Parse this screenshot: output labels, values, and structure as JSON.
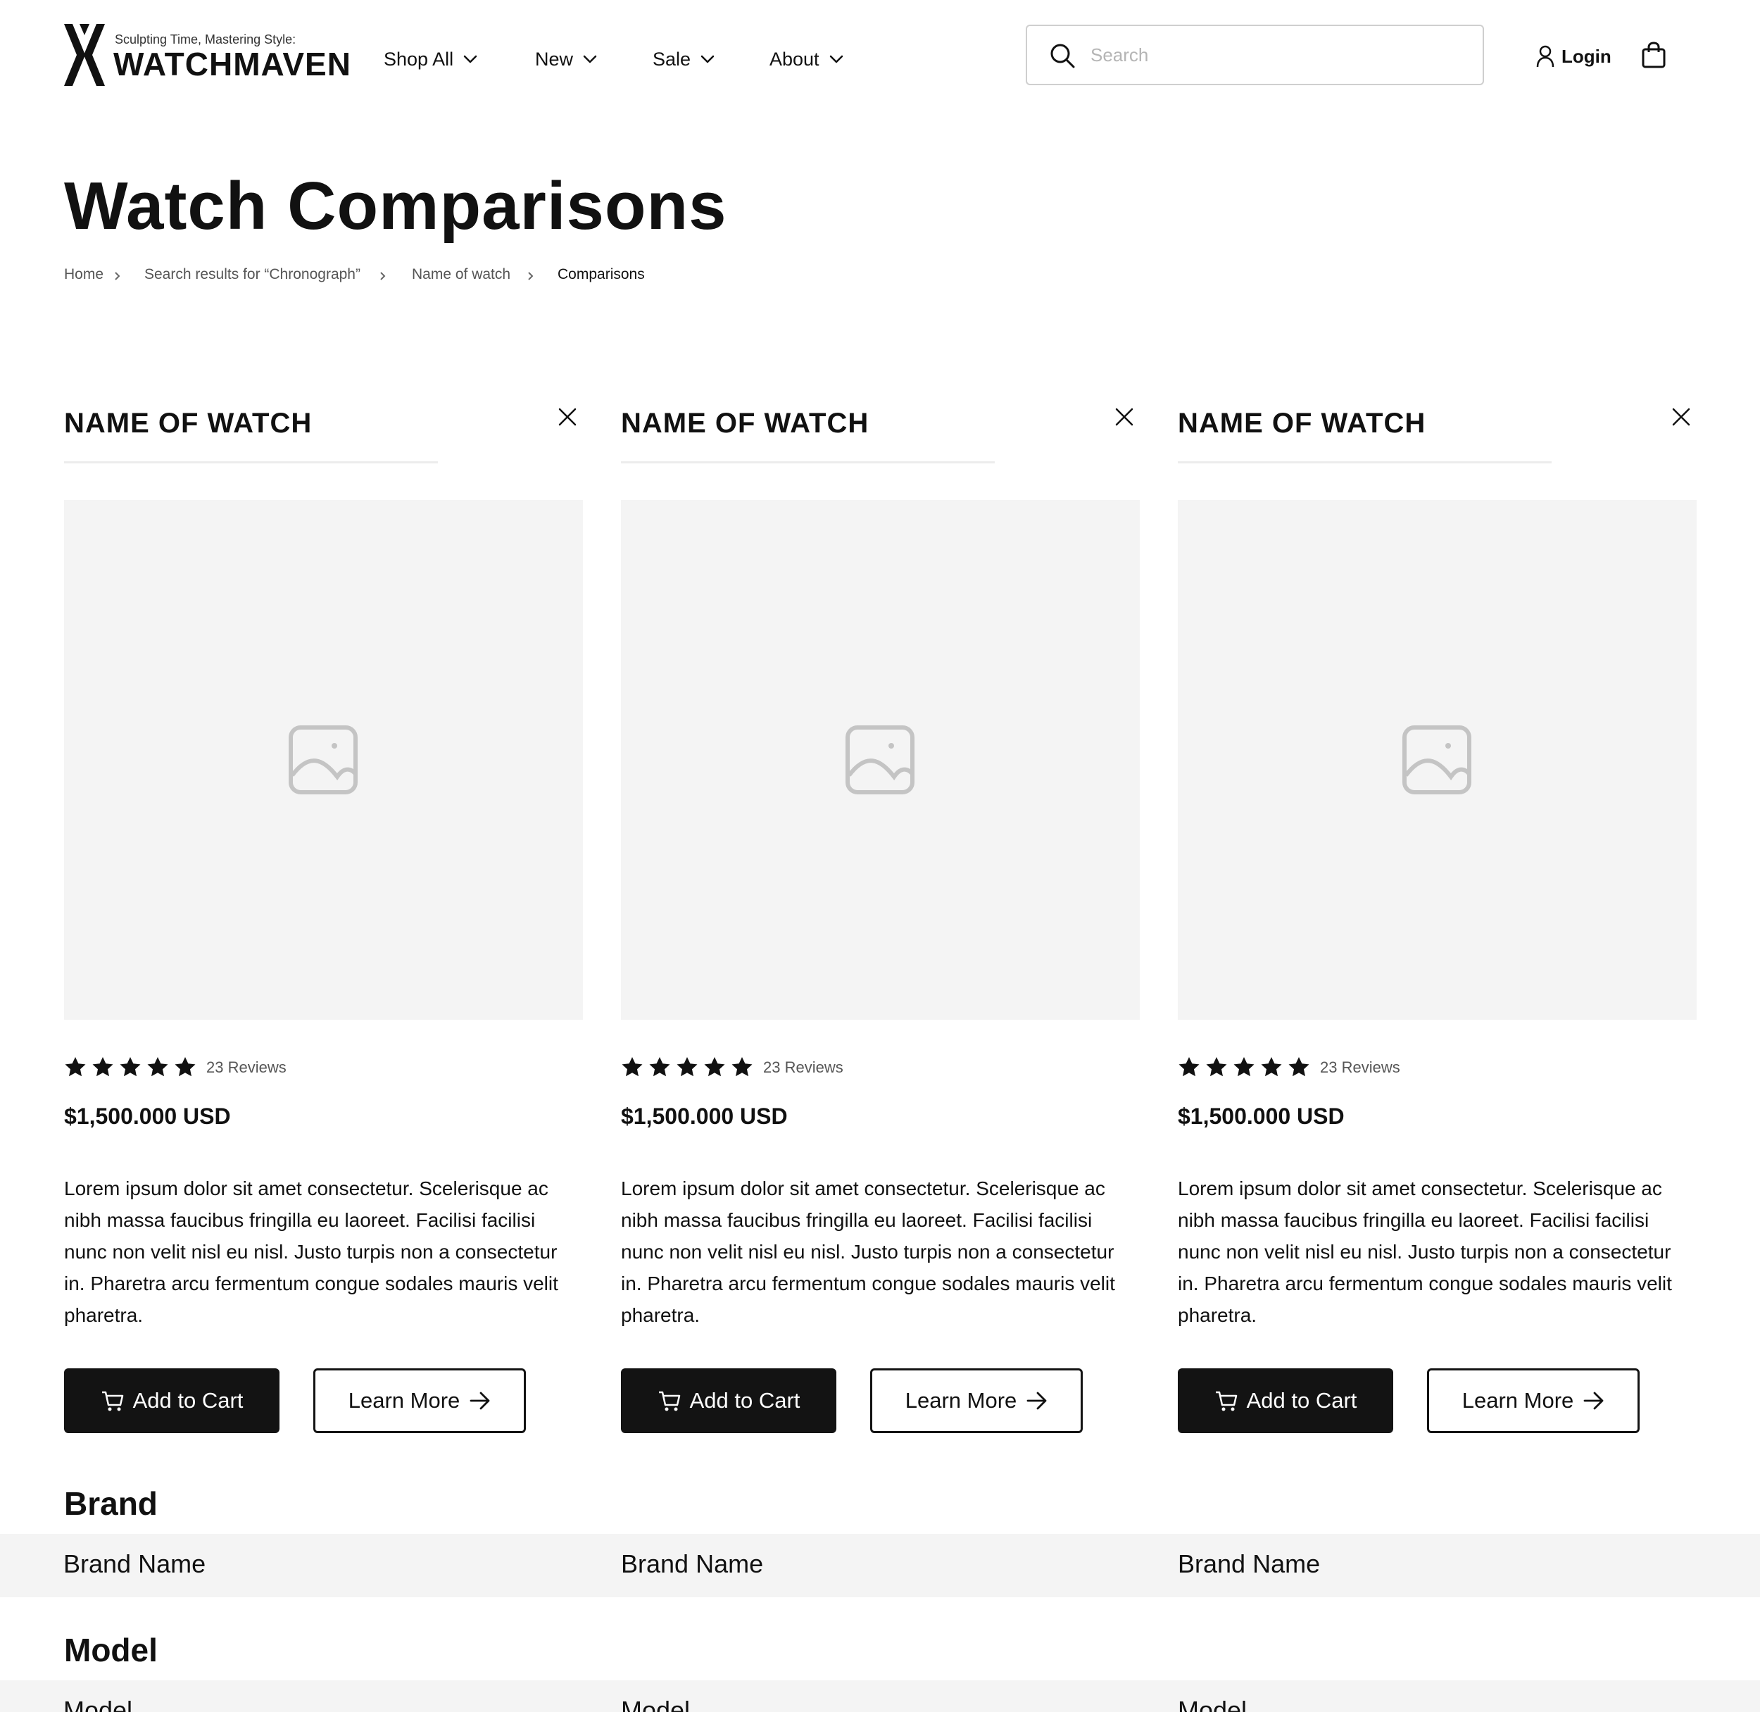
{
  "brand": {
    "tagline": "Sculpting Time, Mastering Style:",
    "name": "WATCHMAVEN"
  },
  "nav": [
    {
      "label": "Shop All"
    },
    {
      "label": "New"
    },
    {
      "label": "Sale"
    },
    {
      "label": "About"
    }
  ],
  "search": {
    "placeholder": "Search",
    "value": ""
  },
  "account": {
    "login_label": "Login"
  },
  "page": {
    "title": "Watch Comparisons"
  },
  "breadcrumb": [
    {
      "label": "Home"
    },
    {
      "label": "Search results for “Chronograph”"
    },
    {
      "label": "Name of watch"
    },
    {
      "label": "Comparisons"
    }
  ],
  "products": [
    {
      "name": "NAME OF WATCH",
      "rating": 5,
      "reviews": "23 Reviews",
      "price": "$1,500.000 USD",
      "description": "Lorem ipsum dolor sit amet consectetur. Scelerisque ac nibh massa faucibus fringilla eu laoreet. Facilisi facilisi nunc non velit nisl eu nisl. Justo turpis non a consectetur in. Pharetra arcu fermentum congue sodales mauris velit pharetra.",
      "add_to_cart": "Add to Cart",
      "learn_more": "Learn More",
      "brand": "Brand Name",
      "model": "Model"
    },
    {
      "name": "NAME OF WATCH",
      "rating": 5,
      "reviews": "23 Reviews",
      "price": "$1,500.000 USD",
      "description": "Lorem ipsum dolor sit amet consectetur. Scelerisque ac nibh massa faucibus fringilla eu laoreet. Facilisi facilisi nunc non velit nisl eu nisl. Justo turpis non a consectetur in. Pharetra arcu fermentum congue sodales mauris velit pharetra.",
      "add_to_cart": "Add to Cart",
      "learn_more": "Learn More",
      "brand": "Brand Name",
      "model": "Model"
    },
    {
      "name": "NAME OF WATCH",
      "rating": 5,
      "reviews": "23 Reviews",
      "price": "$1,500.000 USD",
      "description": "Lorem ipsum dolor sit amet consectetur. Scelerisque ac nibh massa faucibus fringilla eu laoreet. Facilisi facilisi nunc non velit nisl eu nisl. Justo turpis non a consectetur in. Pharetra arcu fermentum congue sodales mauris velit pharetra.",
      "add_to_cart": "Add to Cart",
      "learn_more": "Learn More",
      "brand": "Brand Name",
      "model": "Model"
    }
  ],
  "specs": {
    "brand_heading": "Brand",
    "model_heading": "Model"
  },
  "colors": {
    "primary": "#131313",
    "placeholder_bg": "#f4f4f4",
    "row_bg": "#f4f4f4"
  }
}
